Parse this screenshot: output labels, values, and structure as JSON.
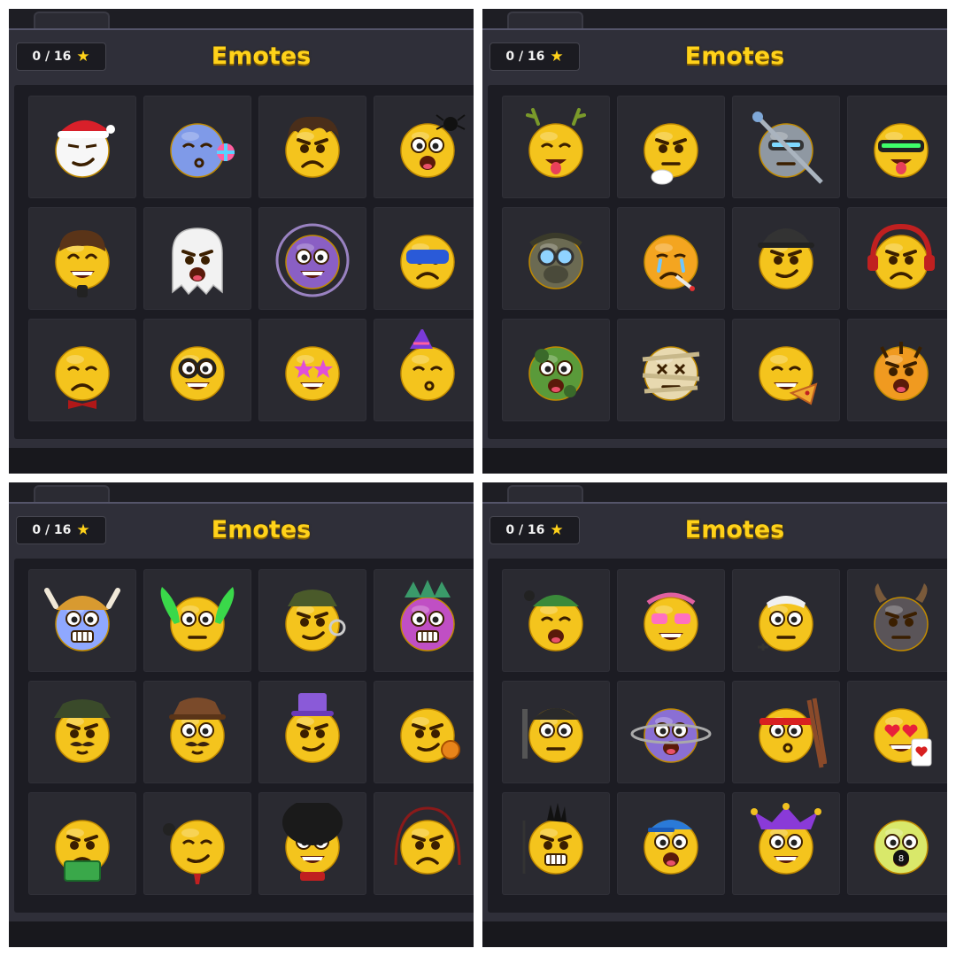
{
  "panels": [
    {
      "counter": "0 / 16",
      "title": "Emotes",
      "emotes": [
        {
          "icon": "santa-emote-icon",
          "base": "#f7f7f7",
          "acc": "santa-hat",
          "mouth": "smirk",
          "eyes": "squint"
        },
        {
          "icon": "cloud-pinwheel-emote-icon",
          "base": "#7f9ae8",
          "acc": "pinwheel",
          "mouth": "kiss",
          "eyes": "closed"
        },
        {
          "icon": "grumpy-shaggy-hair-emote-icon",
          "base": "#f4c41d",
          "acc": "shaggy-hair",
          "mouth": "frown",
          "eyes": "angry"
        },
        {
          "icon": "spider-scared-emote-icon",
          "base": "#f4c41d",
          "acc": "spider",
          "mouth": "open",
          "eyes": "wide"
        },
        {
          "icon": "microphone-singer-emote-icon",
          "base": "#f4c41d",
          "acc": "bowl-hair",
          "mouth": "grin",
          "eyes": "happy"
        },
        {
          "icon": "ghost-emote-icon",
          "base": "#f2f2f2",
          "acc": "ghost",
          "mouth": "open",
          "eyes": "angry"
        },
        {
          "icon": "purple-aura-emote-icon",
          "base": "#8a5fc4",
          "acc": "aura",
          "mouth": "grin",
          "eyes": "wide"
        },
        {
          "icon": "masked-hero-emote-icon",
          "base": "#f4c41d",
          "acc": "blue-mask",
          "mouth": "frown",
          "eyes": "angry"
        },
        {
          "icon": "facepalm-bowtie-emote-icon",
          "base": "#f4c41d",
          "acc": "bowtie",
          "mouth": "frown",
          "eyes": "closed"
        },
        {
          "icon": "nerd-glasses-emote-icon",
          "base": "#f4c41d",
          "acc": "glasses",
          "mouth": "grin",
          "eyes": "wide"
        },
        {
          "icon": "star-eyes-emote-icon",
          "base": "#f4c41d",
          "acc": "star-eyes",
          "mouth": "grin",
          "eyes": "none"
        },
        {
          "icon": "party-hat-emote-icon",
          "base": "#f4c41d",
          "acc": "party-hat",
          "mouth": "kiss",
          "eyes": "closed"
        }
      ]
    },
    {
      "counter": "0 / 16",
      "title": "Emotes",
      "emotes": [
        {
          "icon": "reindeer-tongue-emote-icon",
          "base": "#f4c41d",
          "acc": "antlers",
          "mouth": "tongue",
          "eyes": "closed"
        },
        {
          "icon": "thinking-emote-icon",
          "base": "#f4c41d",
          "acc": "hand",
          "mouth": "flat",
          "eyes": "angry"
        },
        {
          "icon": "robot-spear-emote-icon",
          "base": "#8f98a2",
          "acc": "spear",
          "mouth": "flat",
          "eyes": "visor"
        },
        {
          "icon": "vr-visor-emote-icon",
          "base": "#f4c41d",
          "acc": "green-visor",
          "mouth": "tongue",
          "eyes": "none"
        },
        {
          "icon": "gas-mask-emote-icon",
          "base": "#6b6a52",
          "acc": "gas-mask",
          "mouth": "flat",
          "eyes": "goggles"
        },
        {
          "icon": "crying-sick-emote-icon",
          "base": "#f4a520",
          "acc": "thermometer",
          "mouth": "frown",
          "eyes": "crying"
        },
        {
          "icon": "fedora-smirk-emote-icon",
          "base": "#f4c41d",
          "acc": "fedora",
          "mouth": "smirk",
          "eyes": "angry"
        },
        {
          "icon": "headphones-angry-emote-icon",
          "base": "#f4c41d",
          "acc": "headphones",
          "mouth": "frown",
          "eyes": "angry"
        },
        {
          "icon": "zombie-emote-icon",
          "base": "#5a9a3a",
          "acc": "zombie",
          "mouth": "open",
          "eyes": "wide"
        },
        {
          "icon": "mummy-emote-icon",
          "base": "#e8d9b0",
          "acc": "bandages",
          "mouth": "flat",
          "eyes": "x"
        },
        {
          "icon": "pizza-laugh-emote-icon",
          "base": "#f4c41d",
          "acc": "pizza",
          "mouth": "grin",
          "eyes": "closed"
        },
        {
          "icon": "tiger-roar-emote-icon",
          "base": "#f09a20",
          "acc": "tiger",
          "mouth": "open",
          "eyes": "angry"
        }
      ]
    },
    {
      "counter": "0 / 16",
      "title": "Emotes",
      "emotes": [
        {
          "icon": "viking-frozen-emote-icon",
          "base": "#8fa8ff",
          "acc": "viking-helmet",
          "mouth": "teeth",
          "eyes": "wide"
        },
        {
          "icon": "leaf-wings-archer-emote-icon",
          "base": "#f4c41d",
          "acc": "leaf-wings",
          "mouth": "flat",
          "eyes": "wide"
        },
        {
          "icon": "detective-magnifier-emote-icon",
          "base": "#f4c41d",
          "acc": "green-hat",
          "mouth": "smirk",
          "eyes": "angry"
        },
        {
          "icon": "tiki-mask-emote-icon",
          "base": "#c04fc4",
          "acc": "tiki",
          "mouth": "teeth",
          "eyes": "wide"
        },
        {
          "icon": "mustache-detective-emote-icon",
          "base": "#f4c41d",
          "acc": "green-fedora",
          "mouth": "mustache",
          "eyes": "angry"
        },
        {
          "icon": "cowboy-mustache-emote-icon",
          "base": "#f4c41d",
          "acc": "brown-hat",
          "mouth": "mustache",
          "eyes": "wide"
        },
        {
          "icon": "top-hat-scroll-emote-icon",
          "base": "#f4c41d",
          "acc": "purple-top-hat",
          "mouth": "smirk",
          "eyes": "angry"
        },
        {
          "icon": "coin-offer-emote-icon",
          "base": "#f4c41d",
          "acc": "coin",
          "mouth": "smirk",
          "eyes": "angry"
        },
        {
          "icon": "money-grumpy-emote-icon",
          "base": "#f4c41d",
          "acc": "cash",
          "mouth": "frown",
          "eyes": "angry"
        },
        {
          "icon": "smug-eight-ball-emote-icon",
          "base": "#f4c41d",
          "acc": "tie",
          "mouth": "smirk",
          "eyes": "closed"
        },
        {
          "icon": "royal-guard-emote-icon",
          "base": "#f4c41d",
          "acc": "bearskin",
          "mouth": "grin",
          "eyes": "wide"
        },
        {
          "icon": "jump-rope-angry-emote-icon",
          "base": "#f4c41d",
          "acc": "rope",
          "mouth": "frown",
          "eyes": "angry"
        }
      ]
    },
    {
      "counter": "0 / 16",
      "title": "Emotes",
      "emotes": [
        {
          "icon": "yawning-beanie-emote-icon",
          "base": "#f4c41d",
          "acc": "green-beanie",
          "mouth": "open",
          "eyes": "closed"
        },
        {
          "icon": "pink-sunglasses-emote-icon",
          "base": "#f4c41d",
          "acc": "pink-shades",
          "mouth": "grin",
          "eyes": "none"
        },
        {
          "icon": "bandana-thumbs-emote-icon",
          "base": "#f4c41d",
          "acc": "white-bandana",
          "mouth": "flat",
          "eyes": "wide"
        },
        {
          "icon": "bull-horns-emote-icon",
          "base": "#5a5458",
          "acc": "horns",
          "mouth": "flat",
          "eyes": "angry"
        },
        {
          "icon": "peeking-beanie-emote-icon",
          "base": "#f4c41d",
          "acc": "black-beanie",
          "mouth": "flat",
          "eyes": "wide"
        },
        {
          "icon": "planet-emote-icon",
          "base": "#8a6fd4",
          "acc": "ring",
          "mouth": "open",
          "eyes": "wide"
        },
        {
          "icon": "pool-cues-headband-emote-icon",
          "base": "#f4c41d",
          "acc": "red-headband",
          "mouth": "kiss",
          "eyes": "wide"
        },
        {
          "icon": "heart-eyes-card-emote-icon",
          "base": "#f4c41d",
          "acc": "card",
          "mouth": "grin",
          "eyes": "hearts"
        },
        {
          "icon": "punk-microphone-emote-icon",
          "base": "#f4c41d",
          "acc": "mohawk",
          "mouth": "teeth",
          "eyes": "angry"
        },
        {
          "icon": "drummer-cap-emote-icon",
          "base": "#f4c41d",
          "acc": "blue-cap",
          "mouth": "open",
          "eyes": "wide"
        },
        {
          "icon": "jester-cocktail-emote-icon",
          "base": "#f4c41d",
          "acc": "jester-hat",
          "mouth": "grin",
          "eyes": "wide"
        },
        {
          "icon": "eight-ball-hands-up-emote-icon",
          "base": "#d9e86a",
          "acc": "eight-ball",
          "mouth": "open",
          "eyes": "wide"
        }
      ]
    }
  ]
}
